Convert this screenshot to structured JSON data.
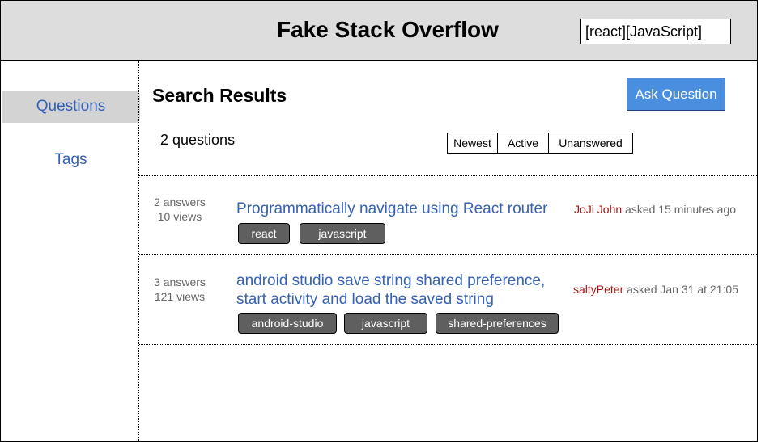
{
  "header": {
    "title": "Fake Stack Overflow",
    "search_value": "[react][JavaScript]"
  },
  "sidebar": {
    "items": [
      {
        "label": "Questions",
        "active": true
      },
      {
        "label": "Tags",
        "active": false
      }
    ]
  },
  "main": {
    "heading": "Search Results",
    "ask_button": "Ask Question",
    "count_text": "2 questions",
    "sort_options": [
      "Newest",
      "Active",
      "Unanswered"
    ]
  },
  "questions": [
    {
      "answers": "2 answers",
      "views": "10 views",
      "title": "Programmatically navigate using React router",
      "author": "JoJi John",
      "asked": "asked 15 minutes ago",
      "tags": [
        "react",
        "javascript"
      ]
    },
    {
      "answers": "3 answers",
      "views": "121 views",
      "title": "android studio save string shared preference, start activity and load the saved string",
      "author": "saltyPeter",
      "asked": "asked Jan 31 at 21:05",
      "tags": [
        "android-studio",
        "javascript",
        "shared-preferences"
      ]
    }
  ],
  "colors": {
    "header_bg": "#dddddd",
    "link_blue": "#3460b5",
    "author_red": "#a31515",
    "ask_button_bg": "#4a8ee0",
    "tag_bg": "#5f5f5f"
  }
}
